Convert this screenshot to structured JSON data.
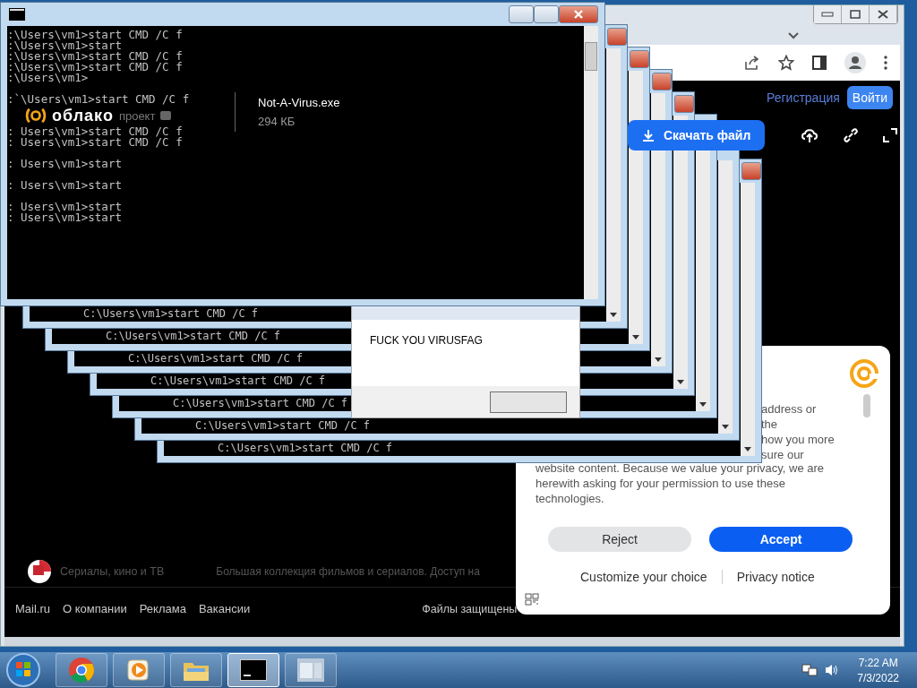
{
  "browser": {
    "header": {
      "register_link": "Регистрация",
      "login_button": "Войти"
    },
    "file": {
      "brand": "облако",
      "brand_tag": "проект",
      "name": "Not-A-Virus.exe",
      "size": "294 КБ"
    },
    "download_button": "Скачать файл",
    "promo": {
      "title": "Сериалы, кино и ТВ",
      "text": "Большая коллекция фильмов и сериалов. Доступ на"
    },
    "footer_links": [
      "Mail.ru",
      "О компании",
      "Реклама",
      "Вакансии"
    ],
    "footer_note": "Файлы защищены"
  },
  "cookie_dialog": {
    "partial_lines": [
      "address or",
      "the",
      "how you more",
      "sure our"
    ],
    "text": "website content. Because we value your privacy, we are herewith asking for your permission to use these technologies.",
    "reject_button": "Reject",
    "accept_button": "Accept",
    "customize_link": "Customize your choice",
    "privacy_link": "Privacy notice"
  },
  "console": {
    "lines": [
      {
        "text": ":\\Users\\vm1>start CMD /C f",
        "gap": false
      },
      {
        "text": ":\\Users\\vm1>start",
        "gap": false
      },
      {
        "text": ":\\Users\\vm1>start CMD /C f",
        "gap": false
      },
      {
        "text": ":\\Users\\vm1>start CMD /C f",
        "gap": false
      },
      {
        "text": ":\\Users\\vm1>",
        "gap": false
      },
      {
        "text": ":`\\Users\\vm1>start CMD /C f",
        "gap": true
      },
      {
        "text": ": Users\\vm1>start CMD /C f",
        "gap": false
      },
      {
        "text": ": Users\\vm1>start CMD /C f",
        "gap": false
      },
      {
        "text": ": Users\\vm1>start",
        "gap": true
      },
      {
        "text": ": Users\\vm1>start",
        "gap": true
      },
      {
        "text": ": Users\\vm1>start",
        "gap": true
      },
      {
        "text": ": Users\\vm1>start",
        "gap": false
      }
    ]
  },
  "cascade_windows": [
    {
      "line": "C:\\Users\\vm1>start CMD /C f"
    },
    {
      "line": "C:\\Users\\vm1>start CMD /C f"
    },
    {
      "line": "C:\\Users\\vm1>start CMD /C f"
    },
    {
      "line": "C:\\Users\\vm1>start CMD /C f"
    },
    {
      "line": "C:\\Users\\vm1>start CMD /C f"
    },
    {
      "line": "C:\\Users\\vm1>start CMD /C f"
    },
    {
      "line": "C:\\Users\\vm1>start CMD /C f"
    }
  ],
  "message_box": {
    "text": "FUCK YOU VIRUSFAG"
  },
  "taskbar": {
    "apps": [
      {
        "kind": "chrome",
        "selected": false
      },
      {
        "kind": "media",
        "selected": false
      },
      {
        "kind": "explorer",
        "selected": false
      },
      {
        "kind": "console",
        "selected": true
      },
      {
        "kind": "window",
        "selected": false
      }
    ],
    "time": "7:22 AM",
    "date": "7/3/2022"
  }
}
